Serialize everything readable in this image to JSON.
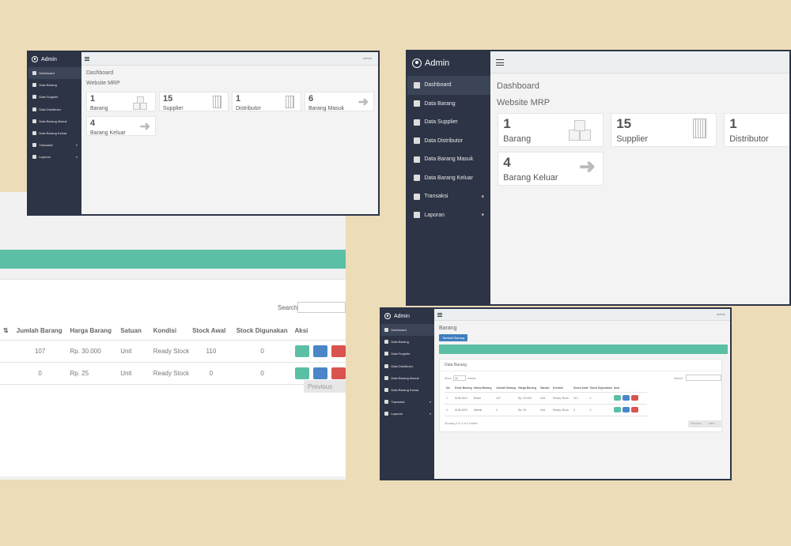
{
  "app": {
    "brand": "Admin",
    "user": "admin",
    "title": "Dashboard",
    "subtitle": "Website MRP"
  },
  "sidebar": {
    "items": [
      {
        "label": "Dashboard",
        "icon": "dashboard-icon"
      },
      {
        "label": "Data Barang",
        "icon": "cubes-icon"
      },
      {
        "label": "Data Supplier",
        "icon": "book-icon"
      },
      {
        "label": "Data Distributor",
        "icon": "building-icon"
      },
      {
        "label": "Data Barang Masuk",
        "icon": "sign-in-icon"
      },
      {
        "label": "Data Barang Keluar",
        "icon": "sign-out-icon"
      },
      {
        "label": "Transaksi",
        "icon": "truck-icon"
      },
      {
        "label": "Laporan",
        "icon": "file-icon"
      }
    ]
  },
  "cards": [
    {
      "value": "1",
      "label": "Barang",
      "icon": "cubes-icon"
    },
    {
      "value": "15",
      "label": "Supplier",
      "icon": "building-icon"
    },
    {
      "value": "1",
      "label": "Distributor",
      "icon": "building-icon"
    },
    {
      "value": "6",
      "label": "Barang Masuk",
      "icon": "sign-in-icon"
    },
    {
      "value": "4",
      "label": "Barang Keluar",
      "icon": "sign-out-icon"
    }
  ],
  "barang_page": {
    "title": "Barang",
    "add_button": "Tambah Barang",
    "section_title": "Data Barang",
    "show_label": "Show",
    "entries_label": "entries",
    "entries_value": "10",
    "search_label": "Search:",
    "columns": [
      "No",
      "Kode Barang",
      "Nama Barang",
      "Jumlah Barang",
      "Harga Barang",
      "Satuan",
      "Kondisi",
      "Stock Awal",
      "Stock Digunakan",
      "Aksi"
    ],
    "rows": [
      [
        "1",
        "KDB-0001",
        "Beam",
        "107",
        "Rp. 30.000",
        "Unit",
        "Ready Stock",
        "110",
        "0"
      ],
      [
        "2",
        "KDB-0002",
        "Mikrak",
        "0",
        "Rp. 25",
        "Unit",
        "Ready Stock",
        "0",
        "0"
      ]
    ],
    "showing": "Showing 1 to 2 of 2 entries",
    "previous": "Previous",
    "next": "Next"
  },
  "colors": {
    "sidebar": "#2d3446",
    "accent": "#5bbfa5",
    "blue": "#4a86c8",
    "red": "#d9534f"
  }
}
